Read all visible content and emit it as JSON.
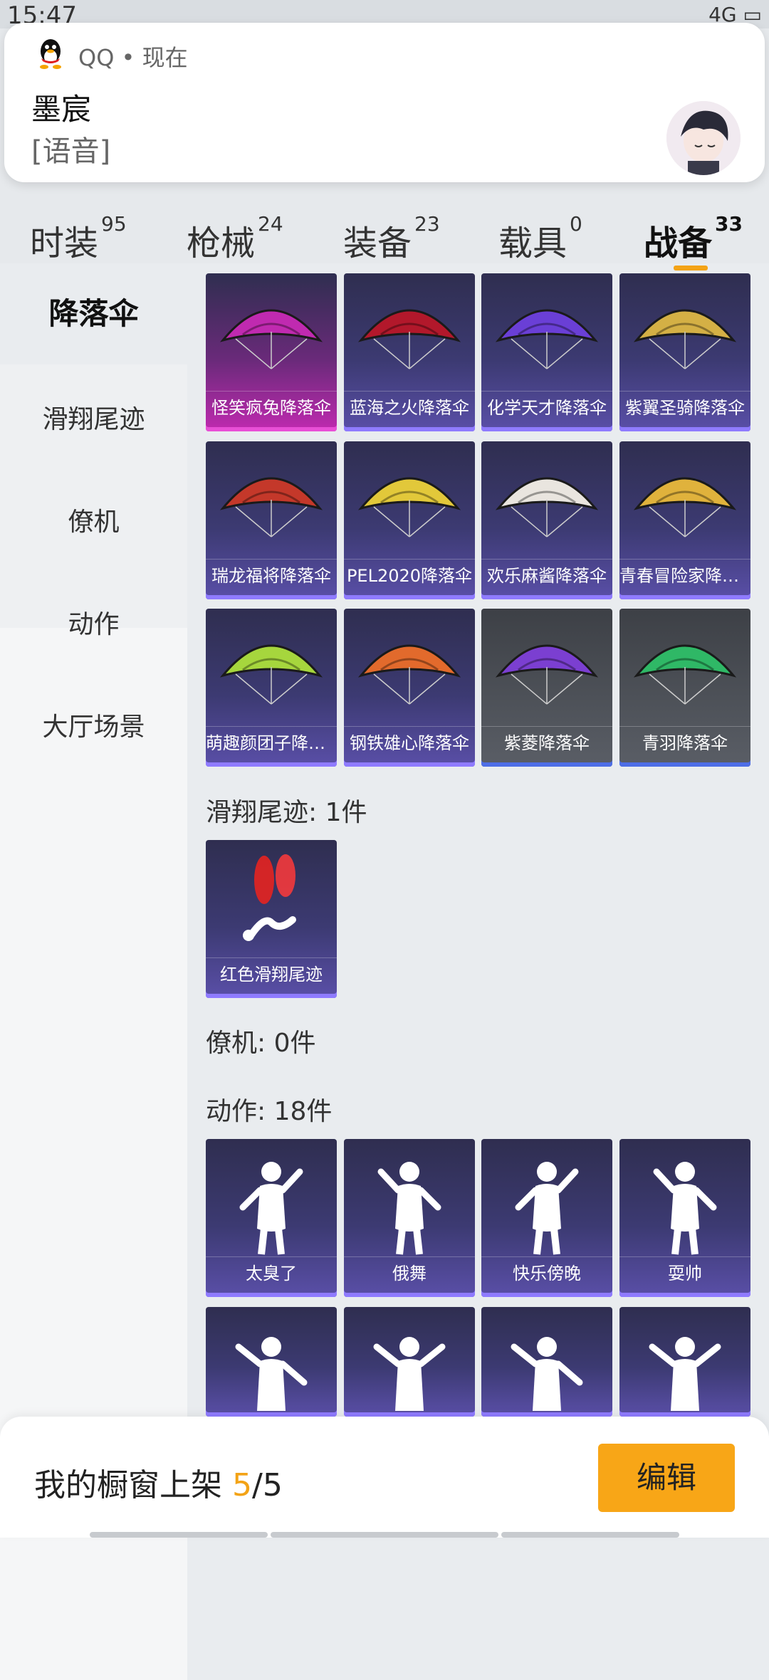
{
  "status_bar": {
    "time": "15:47",
    "network": "4G"
  },
  "notification": {
    "app_name": "QQ",
    "separator": "•",
    "time": "现在",
    "title": "墨宸",
    "body": "[语音]"
  },
  "tabs": [
    {
      "label": "时装",
      "count": "95"
    },
    {
      "label": "枪械",
      "count": "24"
    },
    {
      "label": "装备",
      "count": "23"
    },
    {
      "label": "载具",
      "count": "0"
    },
    {
      "label": "战备",
      "count": "33"
    }
  ],
  "sidebar": [
    {
      "label": "降落伞"
    },
    {
      "label": "滑翔尾迹"
    },
    {
      "label": "僚机"
    },
    {
      "label": "动作"
    },
    {
      "label": "大厅场景"
    }
  ],
  "parachutes": [
    {
      "name": "怪笑疯兔降落伞",
      "color": "#c02ab0"
    },
    {
      "name": "蓝海之火降落伞",
      "color": "#b2182b"
    },
    {
      "name": "化学天才降落伞",
      "color": "#6a3fd6"
    },
    {
      "name": "紫翼圣骑降落伞",
      "color": "#d4b045"
    },
    {
      "name": "瑞龙福将降落伞",
      "color": "#c4382a"
    },
    {
      "name": "PEL2020降落伞",
      "color": "#e2c83a"
    },
    {
      "name": "欢乐麻酱降落伞",
      "color": "#e9e5df"
    },
    {
      "name": "青春冒险家降落...",
      "color": "#e0b23c"
    },
    {
      "name": "萌趣颜团子降落...",
      "color": "#a6d63d"
    },
    {
      "name": "钢铁雄心降落伞",
      "color": "#e26a2c"
    },
    {
      "name": "紫菱降落伞",
      "color": "#7b3fd1"
    },
    {
      "name": "青羽降落伞",
      "color": "#2fb866"
    }
  ],
  "glide_trail_section": {
    "title": "滑翔尾迹: 1件",
    "items": [
      {
        "name": "红色滑翔尾迹"
      }
    ]
  },
  "wingman_section": {
    "title": "僚机: 0件"
  },
  "emote_section": {
    "title": "动作: 18件",
    "items": [
      {
        "name": "太臭了"
      },
      {
        "name": "俄舞"
      },
      {
        "name": "快乐傍晚"
      },
      {
        "name": "耍帅"
      }
    ]
  },
  "bottom_bar": {
    "text": "我的橱窗上架",
    "current": "5",
    "slash": "/",
    "total": "5",
    "edit_label": "编辑"
  }
}
